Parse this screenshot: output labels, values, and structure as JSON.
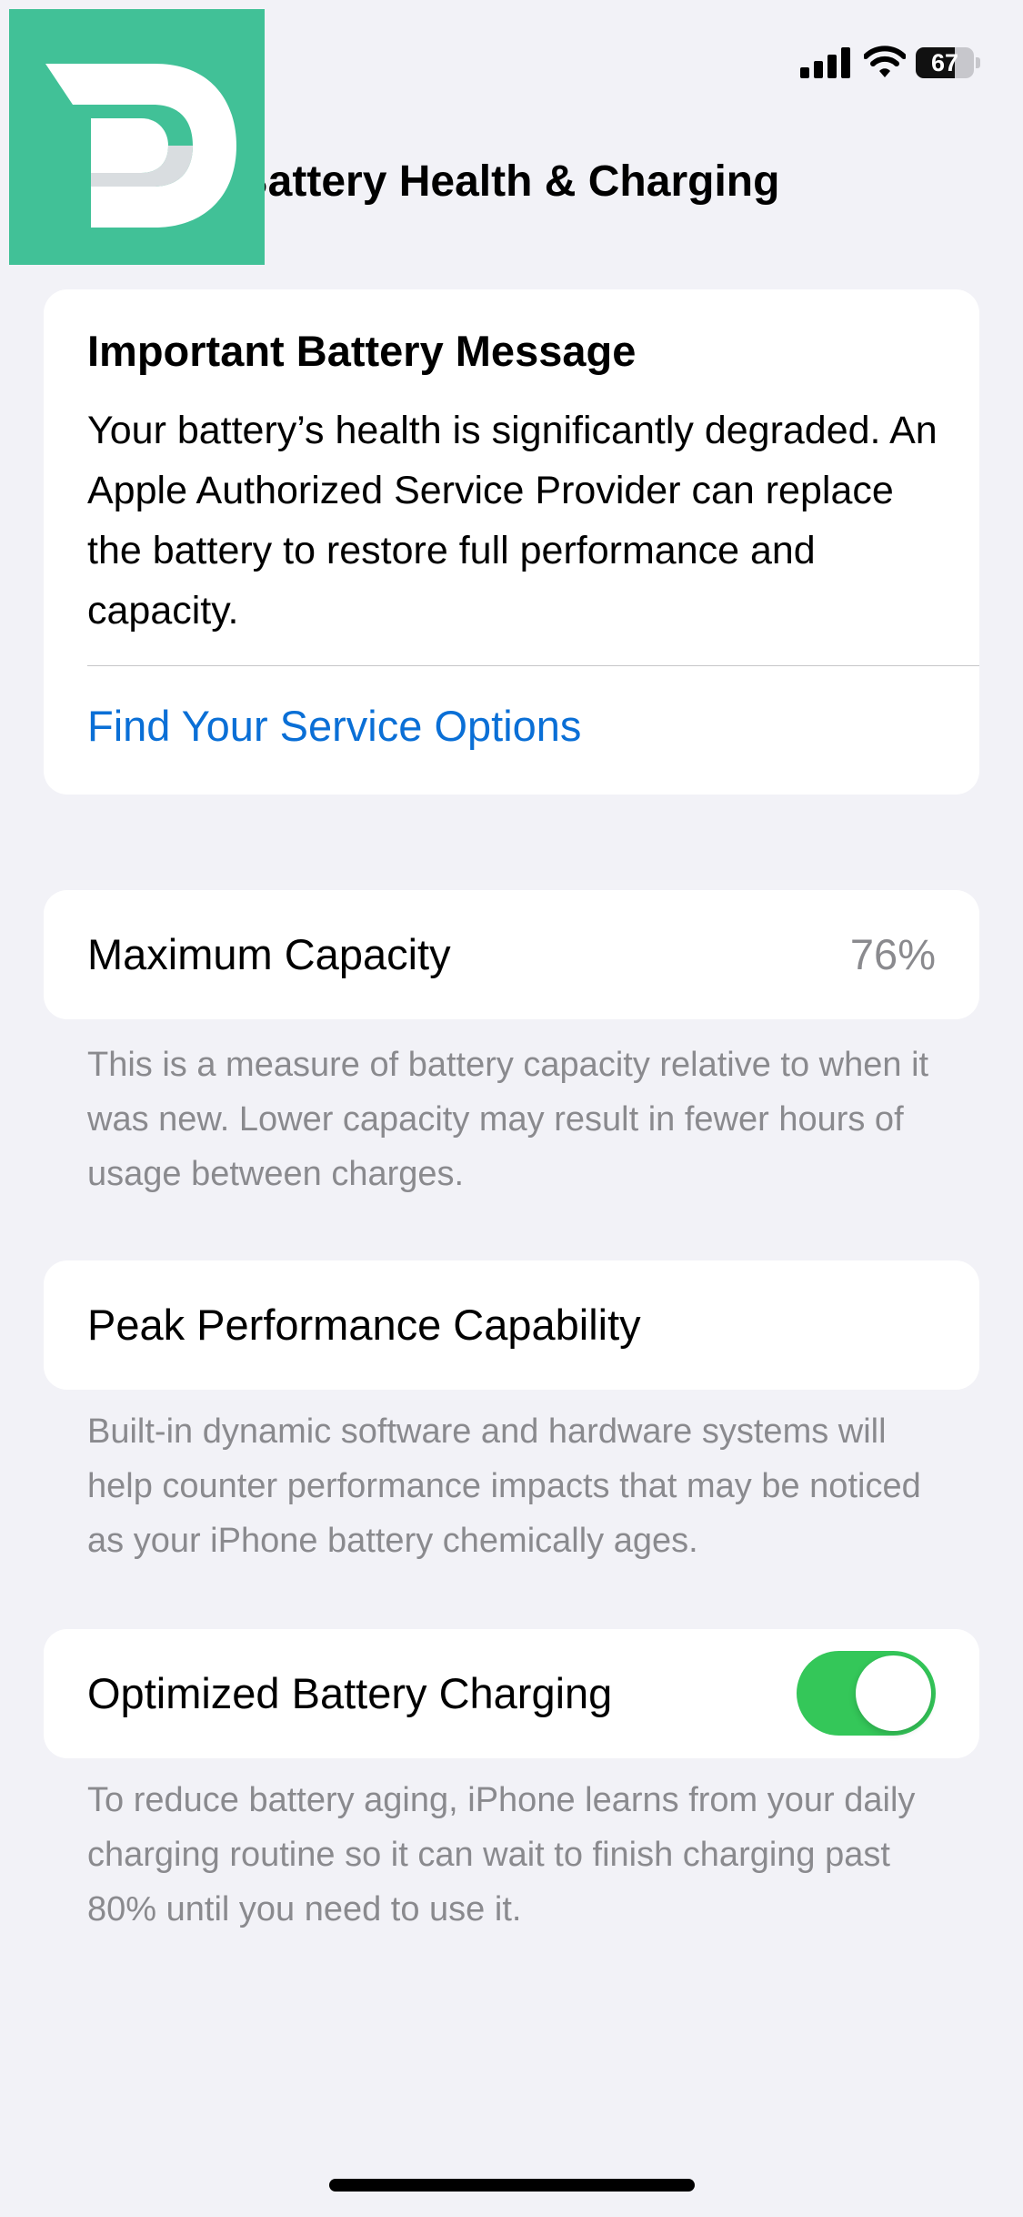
{
  "status_bar": {
    "battery_level": "67",
    "battery_fraction": 0.67,
    "icons": [
      "cellular-signal-icon",
      "wifi-icon",
      "battery-icon"
    ]
  },
  "logo": {
    "icon": "d-logo-icon",
    "background_color": "#41c197"
  },
  "nav": {
    "title": "Battery Health & Charging"
  },
  "battery_message": {
    "title": "Important Battery Message",
    "body": "Your battery’s health is significantly degraded. An Apple Authorized Service Provider can replace the battery to restore full performance and capacity.",
    "link_label": "Find Your Service Options",
    "link_color": "#0a6fd6"
  },
  "maximum_capacity": {
    "label": "Maximum Capacity",
    "value": "76%",
    "footnote": "This is a measure of battery capacity relative to when it was new. Lower capacity may result in fewer hours of usage between charges."
  },
  "peak_performance": {
    "label": "Peak Performance Capability",
    "footnote": "Built-in dynamic software and hardware systems will help counter performance impacts that may be noticed as your iPhone battery chemically ages."
  },
  "optimized_charging": {
    "label": "Optimized Battery Charging",
    "enabled": true,
    "toggle_color": "#34c759",
    "footnote": "To reduce battery aging, iPhone learns from your daily charging routine so it can wait to finish charging past 80% until you need to use it."
  }
}
